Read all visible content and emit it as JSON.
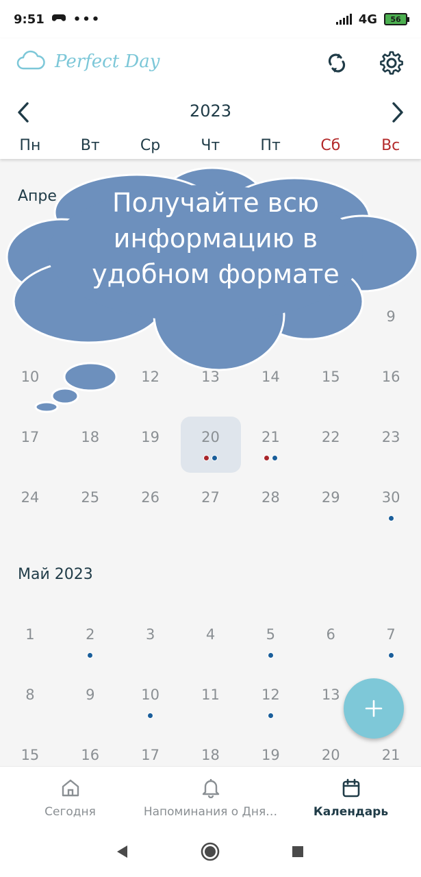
{
  "status": {
    "time": "9:51",
    "network": "4G",
    "battery": "56"
  },
  "app": {
    "brand": "Perfect Day"
  },
  "calendar": {
    "year": "2023",
    "weekdays": [
      "Пн",
      "Вт",
      "Ср",
      "Чт",
      "Пт",
      "Сб",
      "Вс"
    ],
    "april": {
      "title": "Апре",
      "rows": [
        [
          {
            "d": ""
          },
          {
            "d": ""
          },
          {
            "d": ""
          },
          {
            "d": ""
          },
          {
            "d": ""
          },
          {
            "d": ""
          },
          {
            "d": "9"
          }
        ],
        [
          {
            "d": "10"
          },
          {
            "d": ""
          },
          {
            "d": "12"
          },
          {
            "d": "13"
          },
          {
            "d": "14"
          },
          {
            "d": "15"
          },
          {
            "d": "16"
          }
        ],
        [
          {
            "d": "17"
          },
          {
            "d": "18"
          },
          {
            "d": "19"
          },
          {
            "d": "20",
            "today": true,
            "dots": [
              "red",
              "blue"
            ]
          },
          {
            "d": "21",
            "dots": [
              "red",
              "blue"
            ]
          },
          {
            "d": "22"
          },
          {
            "d": "23"
          }
        ],
        [
          {
            "d": "24"
          },
          {
            "d": "25"
          },
          {
            "d": "26"
          },
          {
            "d": "27"
          },
          {
            "d": "28"
          },
          {
            "d": "29"
          },
          {
            "d": "30",
            "dots": [
              "blue"
            ]
          }
        ]
      ]
    },
    "may": {
      "title": "Май 2023",
      "rows": [
        [
          {
            "d": "1"
          },
          {
            "d": "2",
            "dots": [
              "blue"
            ]
          },
          {
            "d": "3"
          },
          {
            "d": "4"
          },
          {
            "d": "5",
            "dots": [
              "blue"
            ]
          },
          {
            "d": "6"
          },
          {
            "d": "7",
            "dots": [
              "blue"
            ]
          }
        ],
        [
          {
            "d": "8"
          },
          {
            "d": "9"
          },
          {
            "d": "10",
            "dots": [
              "blue"
            ]
          },
          {
            "d": "11"
          },
          {
            "d": "12",
            "dots": [
              "blue"
            ]
          },
          {
            "d": "13"
          },
          {
            "d": ""
          }
        ],
        [
          {
            "d": "15"
          },
          {
            "d": "16"
          },
          {
            "d": "17"
          },
          {
            "d": "18"
          },
          {
            "d": "19"
          },
          {
            "d": "20"
          },
          {
            "d": "21"
          }
        ]
      ]
    }
  },
  "promo": {
    "text": "Получайте всю информацию в удобном формате"
  },
  "bottom_nav": [
    {
      "label": "Сегодня",
      "icon": "home-icon"
    },
    {
      "label": "Напоминания о Дня…",
      "icon": "bell-icon"
    },
    {
      "label": "Календарь",
      "icon": "calendar-icon",
      "active": true
    }
  ],
  "colors": {
    "accent": "#7ec8d8",
    "weekend": "#b3292a",
    "cloud": "#6d90bd",
    "dot_red": "#a8262b",
    "dot_blue": "#1a5e9a"
  }
}
